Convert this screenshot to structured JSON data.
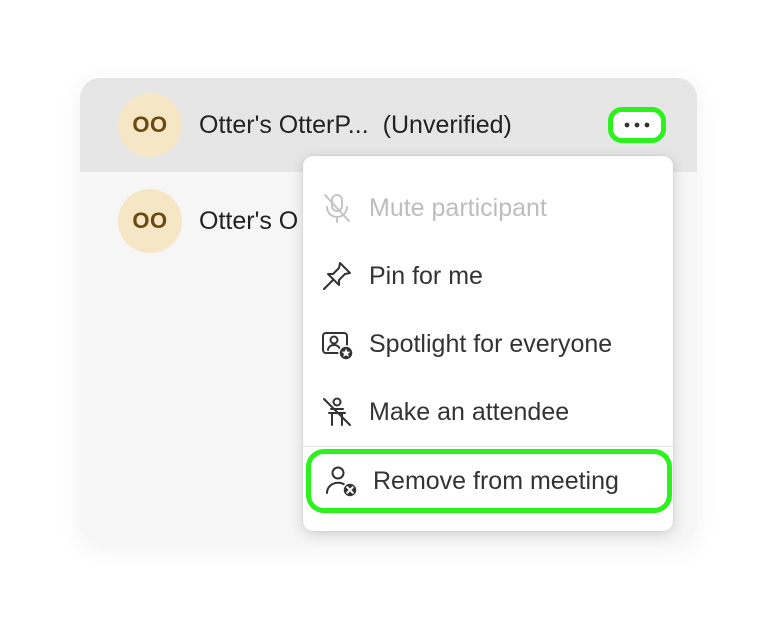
{
  "participants": [
    {
      "initials": "OO",
      "name": "Otter's OtterP...",
      "status": "(Unverified)"
    },
    {
      "initials": "OO",
      "name": "Otter's O"
    }
  ],
  "more_button": {
    "icon": "more-horizontal-icon"
  },
  "menu": {
    "items": [
      {
        "label": "Mute participant",
        "icon": "microphone-off-icon",
        "disabled": true
      },
      {
        "label": "Pin for me",
        "icon": "pin-icon"
      },
      {
        "label": "Spotlight for everyone",
        "icon": "spotlight-icon"
      },
      {
        "label": "Make an attendee",
        "icon": "attendee-off-icon"
      },
      {
        "label": "Remove from meeting",
        "icon": "remove-person-icon"
      }
    ]
  },
  "colors": {
    "highlight": "#2bf11d",
    "avatar_bg": "#f5e6c6",
    "avatar_text": "#6b4a12",
    "disabled_text": "#bdbdbd"
  }
}
